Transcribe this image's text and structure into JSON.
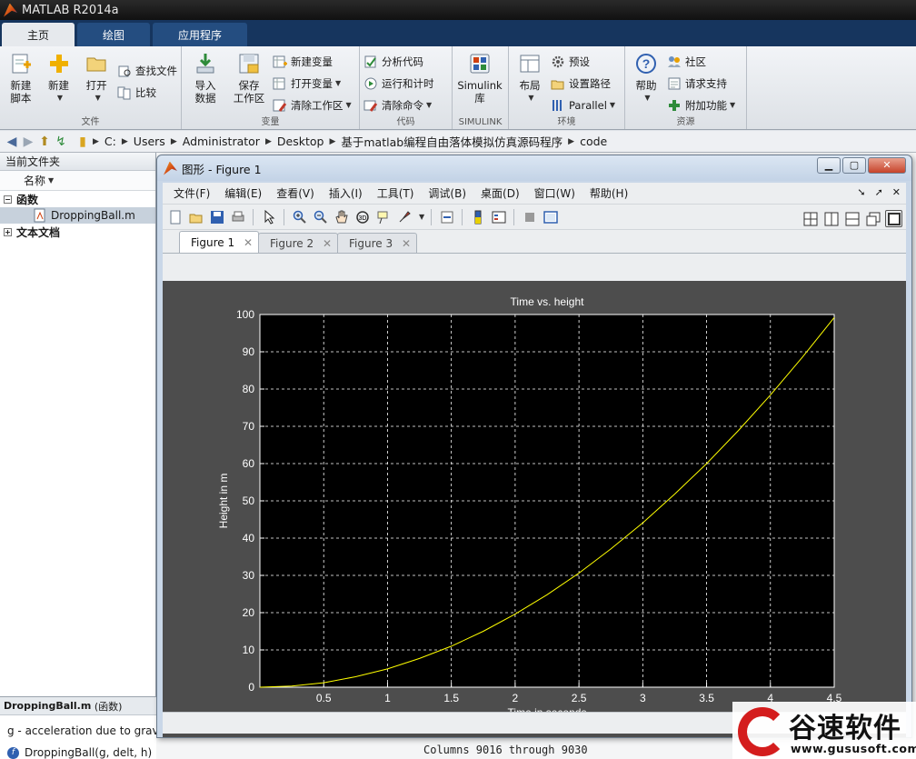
{
  "app": {
    "title": "MATLAB R2014a"
  },
  "ribbon": {
    "tabs": [
      "主页",
      "绘图",
      "应用程序"
    ],
    "groups": {
      "file": {
        "label": "文件",
        "new_script": "新建\n脚本",
        "new": "新建",
        "open": "打开",
        "find_files": "查找文件",
        "compare": "比较"
      },
      "variable": {
        "label": "变量",
        "import_data": "导入\n数据",
        "save_workspace": "保存\n工作区",
        "new_variable": "新建变量",
        "open_variable": "打开变量",
        "clear_workspace": "清除工作区"
      },
      "code": {
        "label": "代码",
        "analyze_code": "分析代码",
        "run_and_time": "运行和计时",
        "clear_commands": "清除命令"
      },
      "simulink": {
        "label": "SIMULINK",
        "simulink_library": "Simulink\n库"
      },
      "environment": {
        "label": "环境",
        "layout": "布局",
        "preferences": "预设",
        "set_path": "设置路径",
        "parallel": "Parallel"
      },
      "resources": {
        "label": "资源",
        "help": "帮助",
        "community": "社区",
        "request_support": "请求支持",
        "add_ons": "附加功能"
      }
    }
  },
  "address": {
    "crumbs": [
      "C:",
      "Users",
      "Administrator",
      "Desktop",
      "基于matlab编程自由落体模拟仿真源码程序",
      "code"
    ]
  },
  "file_panel": {
    "title": "当前文件夹",
    "column": "名称",
    "groups": [
      {
        "label": "函数",
        "expander": "−"
      },
      {
        "label": "文本文档",
        "expander": "+"
      }
    ],
    "selected_file": "DroppingBall.m",
    "details_title": "DroppingBall.m",
    "details_kind": "(函数)",
    "details_desc": "g - acceleration due to grav",
    "details_signature": "DroppingBall(g, delt, h)"
  },
  "command_window": {
    "visible_text": "Columns 9016 through 9030"
  },
  "figure_window": {
    "title": "图形 - Figure 1",
    "menus": [
      "文件(F)",
      "编辑(E)",
      "查看(V)",
      "插入(I)",
      "工具(T)",
      "调试(B)",
      "桌面(D)",
      "窗口(W)",
      "帮助(H)"
    ],
    "tabs": [
      "Figure 1",
      "Figure 2",
      "Figure 3"
    ],
    "active_tab": "Figure 1"
  },
  "chart_data": {
    "type": "line",
    "title": "Time vs. height",
    "xlabel": "Time in seconds",
    "ylabel": "Height in m",
    "xlim": [
      0,
      4.5
    ],
    "ylim": [
      0,
      100
    ],
    "xticks": [
      0.5,
      1,
      1.5,
      2,
      2.5,
      3,
      3.5,
      4,
      4.5
    ],
    "yticks": [
      0,
      10,
      20,
      30,
      40,
      50,
      60,
      70,
      80,
      90,
      100
    ],
    "grid": true,
    "background": "#000000",
    "line_color": "#ffff00",
    "series": [
      {
        "x": [
          0,
          0.25,
          0.5,
          0.75,
          1,
          1.25,
          1.5,
          1.75,
          2,
          2.25,
          2.5,
          2.75,
          3,
          3.25,
          3.5,
          3.75,
          4,
          4.25,
          4.5
        ],
        "y": [
          0,
          0.3,
          1.2,
          2.8,
          4.9,
          7.7,
          11.0,
          15.0,
          19.6,
          24.8,
          30.6,
          37.1,
          44.1,
          51.8,
          60.0,
          68.9,
          78.4,
          88.5,
          99.2
        ]
      }
    ]
  },
  "watermark": {
    "title": "谷速软件",
    "url": "www.gususoft.com"
  }
}
